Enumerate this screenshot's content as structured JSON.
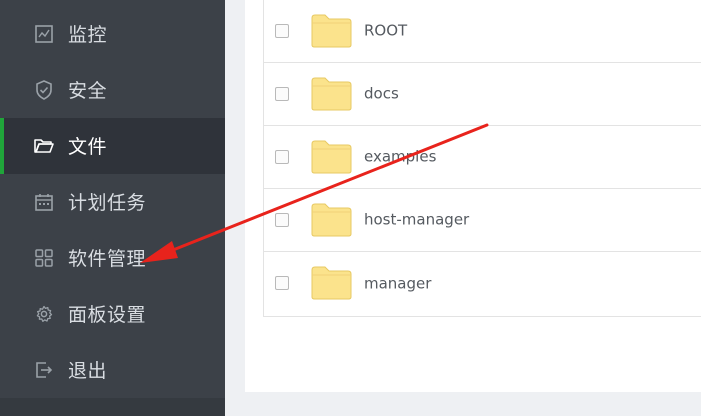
{
  "sidebar": {
    "items": [
      {
        "label": "监控",
        "icon": "monitor-icon",
        "active": false
      },
      {
        "label": "安全",
        "icon": "shield-icon",
        "active": false
      },
      {
        "label": "文件",
        "icon": "folder-icon",
        "active": true
      },
      {
        "label": "计划任务",
        "icon": "calendar-icon",
        "active": false
      },
      {
        "label": "软件管理",
        "icon": "grid-icon",
        "active": false
      },
      {
        "label": "面板设置",
        "icon": "gear-icon",
        "active": false
      },
      {
        "label": "退出",
        "icon": "logout-icon",
        "active": false
      }
    ]
  },
  "files": [
    {
      "name": "ROOT"
    },
    {
      "name": "docs"
    },
    {
      "name": "examples"
    },
    {
      "name": "host-manager"
    },
    {
      "name": "manager"
    }
  ],
  "colors": {
    "sidebar_bg": "#3c4148",
    "active_bg": "#2f333a",
    "accent": "#20a53a",
    "folder_fill": "#fbe38c",
    "arrow": "#e8231c"
  }
}
